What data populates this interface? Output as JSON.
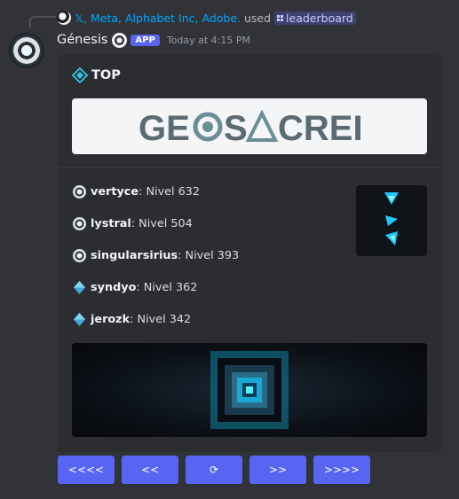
{
  "reply": {
    "users": "𝕏, Meta, Alphabet Inc, Adobe.",
    "used_text": "used",
    "command": "leaderboard"
  },
  "message": {
    "username": "Génesis",
    "badge": "APP",
    "timestamp": "Today at 4:15 PM"
  },
  "embed": {
    "title": "TOP",
    "banner_text": "GEOSACRED",
    "accent_color": "#5865f2",
    "fields": [
      {
        "rank_icon": "ring-medal-icon",
        "name": "vertyce",
        "value": ": Nivel 632"
      },
      {
        "rank_icon": "ring-medal-icon",
        "name": "lystral",
        "value": ": Nivel 504"
      },
      {
        "rank_icon": "ring-medal-icon",
        "name": "singularsirius",
        "value": ": Nivel 393"
      },
      {
        "rank_icon": "blue-diamond-icon",
        "name": "syndyo",
        "value": ": Nivel 362"
      },
      {
        "rank_icon": "blue-diamond-icon",
        "name": "jerozk",
        "value": ": Nivel 342"
      }
    ]
  },
  "buttons": [
    {
      "label": "<<<<"
    },
    {
      "label": "<<"
    },
    {
      "label": "⟳"
    },
    {
      "label": ">>"
    },
    {
      "label": ">>>>"
    }
  ]
}
